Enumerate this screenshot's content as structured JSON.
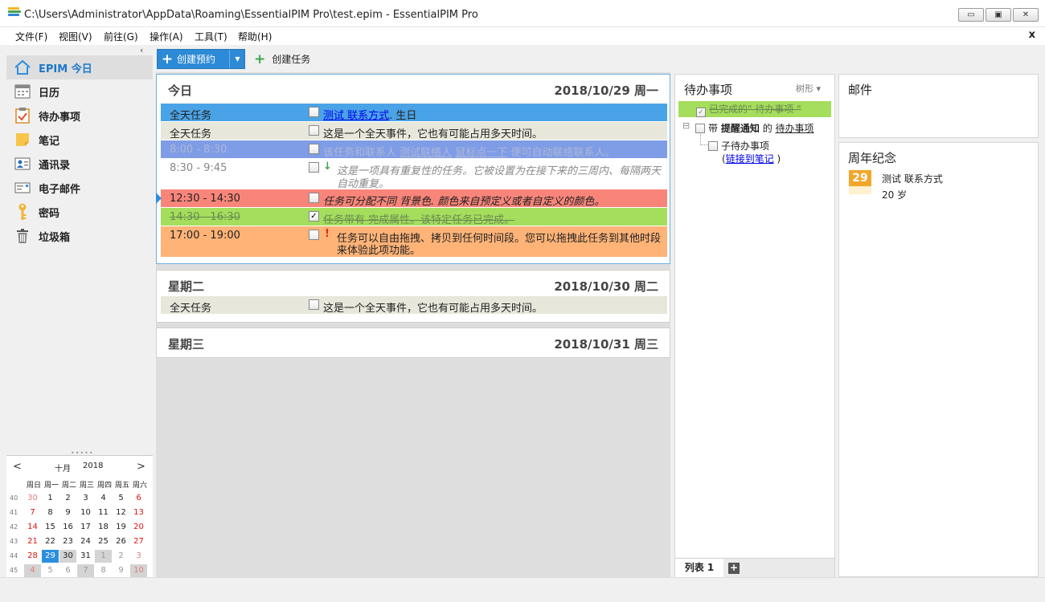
{
  "window": {
    "title": "C:\\Users\\Administrator\\AppData\\Roaming\\EssentialPIM Pro\\test.epim - EssentialPIM Pro",
    "min": "▭",
    "max": "▣",
    "close": "✕"
  },
  "menu": [
    "文件(F)",
    "视图(V)",
    "前往(G)",
    "操作(A)",
    "工具(T)",
    "帮助(H)"
  ],
  "menu_close": "x",
  "sidebar": {
    "collapse": "‹",
    "items": [
      {
        "label": "EPIM 今日",
        "icon": "home-icon"
      },
      {
        "label": "日历",
        "icon": "calendar-icon"
      },
      {
        "label": "待办事项",
        "icon": "clipboard-icon"
      },
      {
        "label": "笔记",
        "icon": "note-icon"
      },
      {
        "label": "通讯录",
        "icon": "contacts-icon"
      },
      {
        "label": "电子邮件",
        "icon": "email-icon"
      },
      {
        "label": "密码",
        "icon": "key-icon"
      },
      {
        "label": "垃圾箱",
        "icon": "trash-icon"
      }
    ],
    "splitter": "•••••"
  },
  "mini_calendar": {
    "prev": "<",
    "next": ">",
    "month": "十月",
    "year": "2018",
    "weekdays": [
      "周日",
      "周一",
      "周二",
      "周三",
      "周四",
      "周五",
      "周六"
    ],
    "weeks": [
      {
        "num": "40",
        "days": [
          "30",
          "1",
          "2",
          "3",
          "4",
          "5",
          "6"
        ]
      },
      {
        "num": "41",
        "days": [
          "7",
          "8",
          "9",
          "10",
          "11",
          "12",
          "13"
        ]
      },
      {
        "num": "42",
        "days": [
          "14",
          "15",
          "16",
          "17",
          "18",
          "19",
          "20"
        ]
      },
      {
        "num": "43",
        "days": [
          "21",
          "22",
          "23",
          "24",
          "25",
          "26",
          "27"
        ]
      },
      {
        "num": "44",
        "days": [
          "28",
          "29",
          "30",
          "31",
          "1",
          "2",
          "3"
        ]
      },
      {
        "num": "45",
        "days": [
          "4",
          "5",
          "6",
          "7",
          "8",
          "9",
          "10"
        ]
      }
    ]
  },
  "toolbar": {
    "create_appt": "创建预约",
    "create_task": "创建任务"
  },
  "days": [
    {
      "title": "今日",
      "date": "2018/10/29 周一",
      "events": [
        {
          "time": "全天任务",
          "text_link": "测试 联系方式",
          "text": ". 生日",
          "bg": "#4aa3e6",
          "checked": false
        },
        {
          "time": "全天任务",
          "text": "这是一个全天事件，它也有可能占用多天时间。",
          "bg": "#e7e7db",
          "checked": false
        },
        {
          "time": "8:00 - 8:30",
          "text_pre": "该任务和联系人",
          "text_link1": "测试联络人",
          "text_mid": "鼠标点一下",
          "text_post": "便可自动联络联系人。",
          "bg": "#7f9ce6",
          "checked": false
        },
        {
          "time": "8:30 - 9:45",
          "mark": "↓",
          "text": "这是一项具有重复性的任务。它被设置为在接下来的三周内、每隔两天",
          "text2": "自动重复。",
          "bg": "#ffffff",
          "checked": false
        },
        {
          "time": "12:30 - 14:30",
          "text": "任务可分配不同 背景色. 颜色来自预定义或者自定义的颜色。",
          "bg": "#f9857a",
          "checked": false
        },
        {
          "time": "14:30 - 16:30",
          "text": "任务带有 完成属性。该特定任务已完成。",
          "bg": "#a5dd5c",
          "checked": true
        },
        {
          "time": "17:00 - 19:00",
          "mark": "!",
          "text": "任务可以自由拖拽、拷贝到任何时间段。您可以拖拽此任务到其他时段",
          "text2": "来体验此项功能。",
          "bg": "#ffb377",
          "checked": false
        }
      ]
    },
    {
      "title": "星期二",
      "date": "2018/10/30 周二",
      "events": [
        {
          "time": "全天任务",
          "text": "这是一个全天事件，它也有可能占用多天时间。",
          "bg": "#e7e7db",
          "checked": false
        }
      ]
    },
    {
      "title": "星期三",
      "date": "2018/10/31 周三",
      "events": []
    }
  ],
  "todo": {
    "title": "待办事项",
    "view": "树形 ▾",
    "items": [
      {
        "text": "已完成的\" 待办事项 \"",
        "checked": true
      },
      {
        "pre": "带",
        "bold": "提醒通知",
        "mid": "的",
        "link": "待办事项",
        "checked": false
      },
      {
        "text": "子待办事项",
        "checked": false
      },
      {
        "pre": "(",
        "link": "链接到笔记",
        "post": ")"
      }
    ],
    "tree_toggle": "⊟",
    "tab": "列表 1",
    "add_tab": "+"
  },
  "mail": {
    "title": "邮件"
  },
  "anniversary": {
    "title": "周年纪念",
    "icon_day": "29",
    "name": "测试 联系方式",
    "age": "20 岁"
  }
}
